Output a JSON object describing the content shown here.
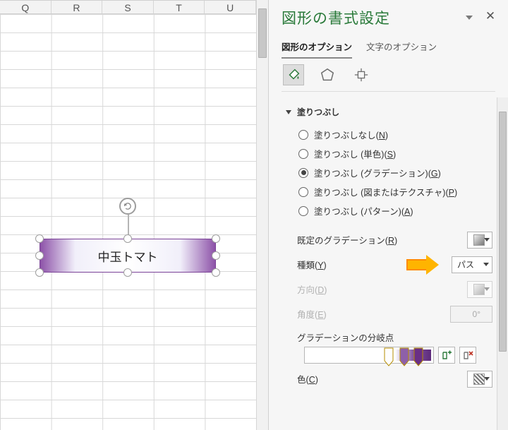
{
  "sheet": {
    "columns": [
      "Q",
      "R",
      "S",
      "T",
      "U"
    ],
    "shape_text": "中玉トマト"
  },
  "pane": {
    "title": "図形の書式設定",
    "tabs": {
      "shape": "図形のオプション",
      "text": "文字のオプション"
    },
    "active_tab": "shape",
    "section": {
      "fill": "塗りつぶし"
    },
    "fill_radios": {
      "none": {
        "label": "塗りつぶしなし",
        "accel": "N"
      },
      "solid": {
        "label": "塗りつぶし (単色)",
        "accel": "S"
      },
      "gradient": {
        "label": "塗りつぶし (グラデーション)",
        "accel": "G"
      },
      "picture": {
        "label": "塗りつぶし (図またはテクスチャ)",
        "accel": "P"
      },
      "pattern": {
        "label": "塗りつぶし (パターン)",
        "accel": "A"
      }
    },
    "fill_selected": "gradient",
    "gradient": {
      "preset_label": "既定のグラデーション",
      "preset_accel": "R",
      "type_label": "種類",
      "type_accel": "Y",
      "type_value": "パス",
      "direction_label": "方向",
      "direction_accel": "D",
      "angle_label": "角度",
      "angle_accel": "E",
      "angle_value": "0°",
      "stops_label": "グラデーションの分岐点",
      "color_label": "色",
      "color_accel": "C"
    }
  }
}
